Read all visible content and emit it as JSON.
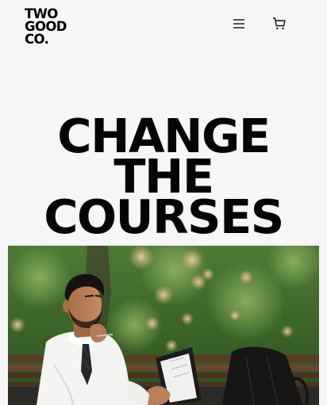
{
  "brand": {
    "logo_lines": [
      "TWO",
      "GOOD",
      "CO."
    ]
  },
  "header": {
    "menu_icon": "hamburger-menu-icon",
    "cart_icon": "shopping-cart-icon"
  },
  "hero": {
    "headline_lines": [
      "CHANGE",
      "THE",
      "COURSES"
    ],
    "image_subject": "man in white shirt and tie sitting on park bench holding pen and clipboard"
  },
  "colors": {
    "background": "#f6f6f6",
    "text": "#050505",
    "foliage": "#3f6a2a",
    "blossom": "#e4b98c"
  }
}
